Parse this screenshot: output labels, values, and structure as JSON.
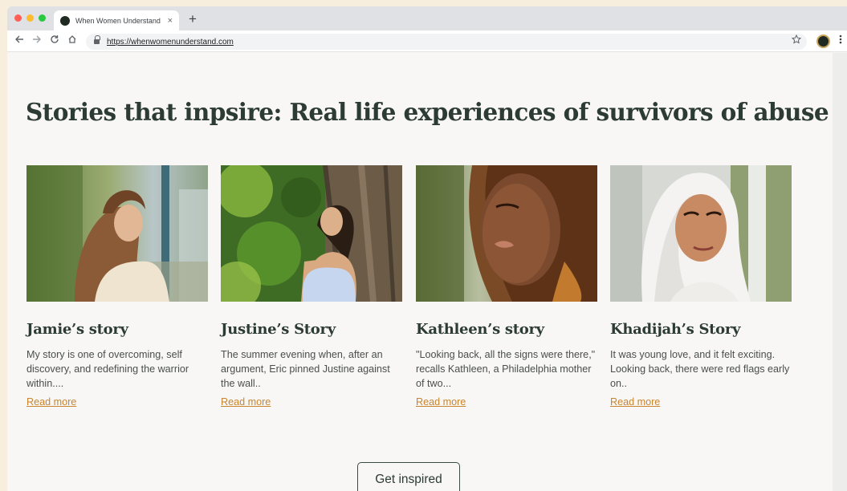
{
  "browser": {
    "tab_title": "When Women Understand",
    "tab_close": "×",
    "new_tab": "+",
    "url": "https://whenwomenunderstand.com",
    "traffic_lights": [
      "#ff5f57",
      "#febc2e",
      "#28c840"
    ]
  },
  "page": {
    "title": "Stories that inpsire: Real life experiences of survivors of abuse",
    "cta_label": "Get inspired"
  },
  "stories": [
    {
      "title": "Jamie’s story",
      "excerpt": "My story is one of overcoming, self discovery, and redefining the warrior within....",
      "link": "Read more"
    },
    {
      "title": "Justine’s Story",
      "excerpt": "The summer evening when, after an argument, Eric pinned Justine against the wall..",
      "link": "Read more"
    },
    {
      "title": "Kathleen’s story",
      "excerpt": "\"Looking back, all the signs were there,\" recalls Kathleen, a Philadelphia mother of two...",
      "link": "Read more"
    },
    {
      "title": "Khadijah’s Story",
      "excerpt": "It was young love, and it felt exciting. Looking back, there were red flags early on..",
      "link": "Read more"
    }
  ],
  "colors": {
    "heading": "#2c3b33",
    "link": "#c8852f",
    "background": "#f8f7f5"
  },
  "icons": {
    "back": "arrow-left-icon",
    "forward": "arrow-right-icon",
    "reload": "reload-icon",
    "home": "home-icon",
    "bookmark": "star-icon",
    "menu": "kebab-menu-icon"
  }
}
